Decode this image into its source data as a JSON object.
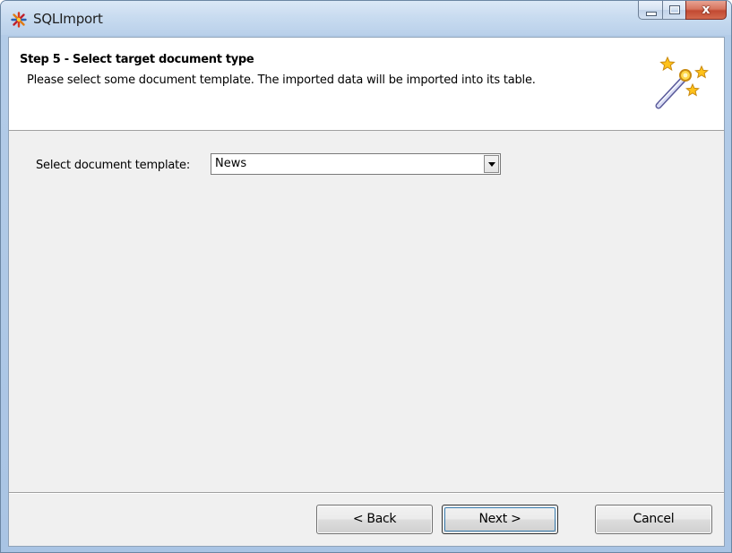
{
  "window": {
    "title": "SQLImport",
    "app_icon": "asterisk-app-icon",
    "caption_buttons": {
      "minimize_icon": "minimize-icon",
      "maximize_icon": "maximize-icon",
      "close_label": "x"
    }
  },
  "header": {
    "step_title": "Step 5 - Select target document type",
    "description": "Please select some document template. The imported data will be imported into its table.",
    "icon": "magic-wand-icon"
  },
  "form": {
    "template_label": "Select document template:",
    "template_value": "News"
  },
  "footer": {
    "back_label": "< Back",
    "next_label": "Next >",
    "cancel_label": "Cancel"
  },
  "colors": {
    "title_bar": "#c9dcf0",
    "client_bg": "#f0f0f0",
    "header_bg": "#ffffff",
    "close_button": "#c24a33",
    "default_button_focus": "#3c7fb1"
  }
}
